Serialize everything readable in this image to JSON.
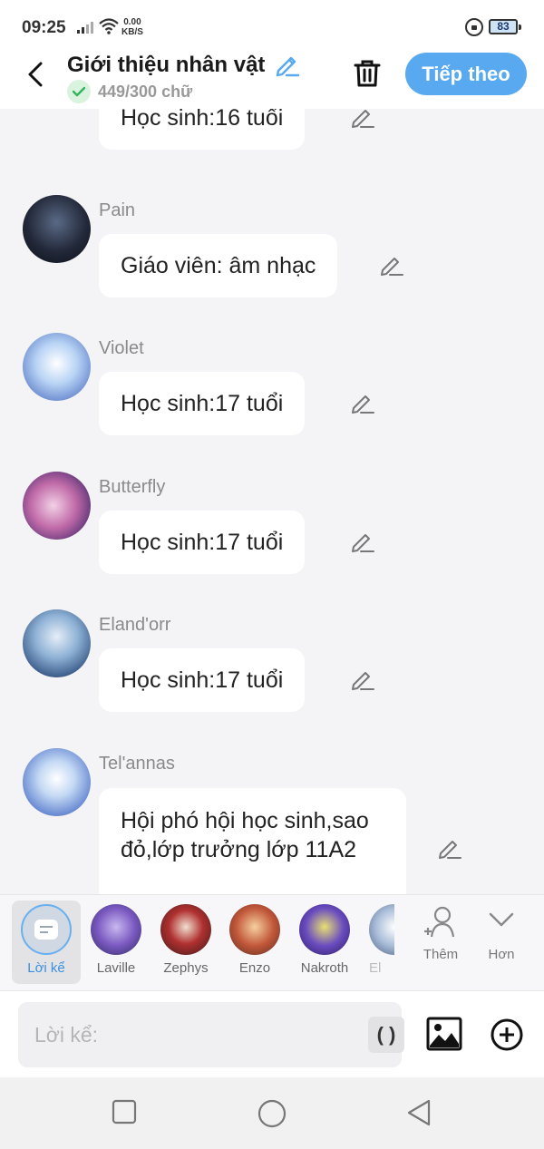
{
  "status": {
    "time": "09:25",
    "speed_top": "0.00",
    "speed_unit": "KB/S",
    "battery": "83"
  },
  "header": {
    "title": "Giới thiệu nhân vật",
    "char_count": "449/300 chữ",
    "next_label": "Tiếp theo"
  },
  "messages": [
    {
      "name": "",
      "text": "Học sinh:16 tuổi"
    },
    {
      "name": "Pain",
      "text": "Giáo viên: âm nhạc"
    },
    {
      "name": "Violet",
      "text": "Học sinh:17 tuổi"
    },
    {
      "name": "Butterfly",
      "text": "Học sinh:17 tuổi"
    },
    {
      "name": "Eland'orr",
      "text": "Học sinh:17 tuổi"
    },
    {
      "name": "Tel'annas",
      "text": "Hội phó hội học sinh,sao đỏ,lớp trưởng lớp 11A2"
    }
  ],
  "characters": [
    {
      "label": "Lời kể"
    },
    {
      "label": "Laville"
    },
    {
      "label": "Zephys"
    },
    {
      "label": "Enzo"
    },
    {
      "label": "Nakroth"
    },
    {
      "label": "El"
    }
  ],
  "add_label": "Thêm",
  "more_label": "Hơn",
  "input": {
    "placeholder": "Lời kể:",
    "paren": "( )"
  },
  "colors": {
    "accent": "#58a9f0",
    "background": "#f4f4f6",
    "bubble": "#ffffff"
  }
}
